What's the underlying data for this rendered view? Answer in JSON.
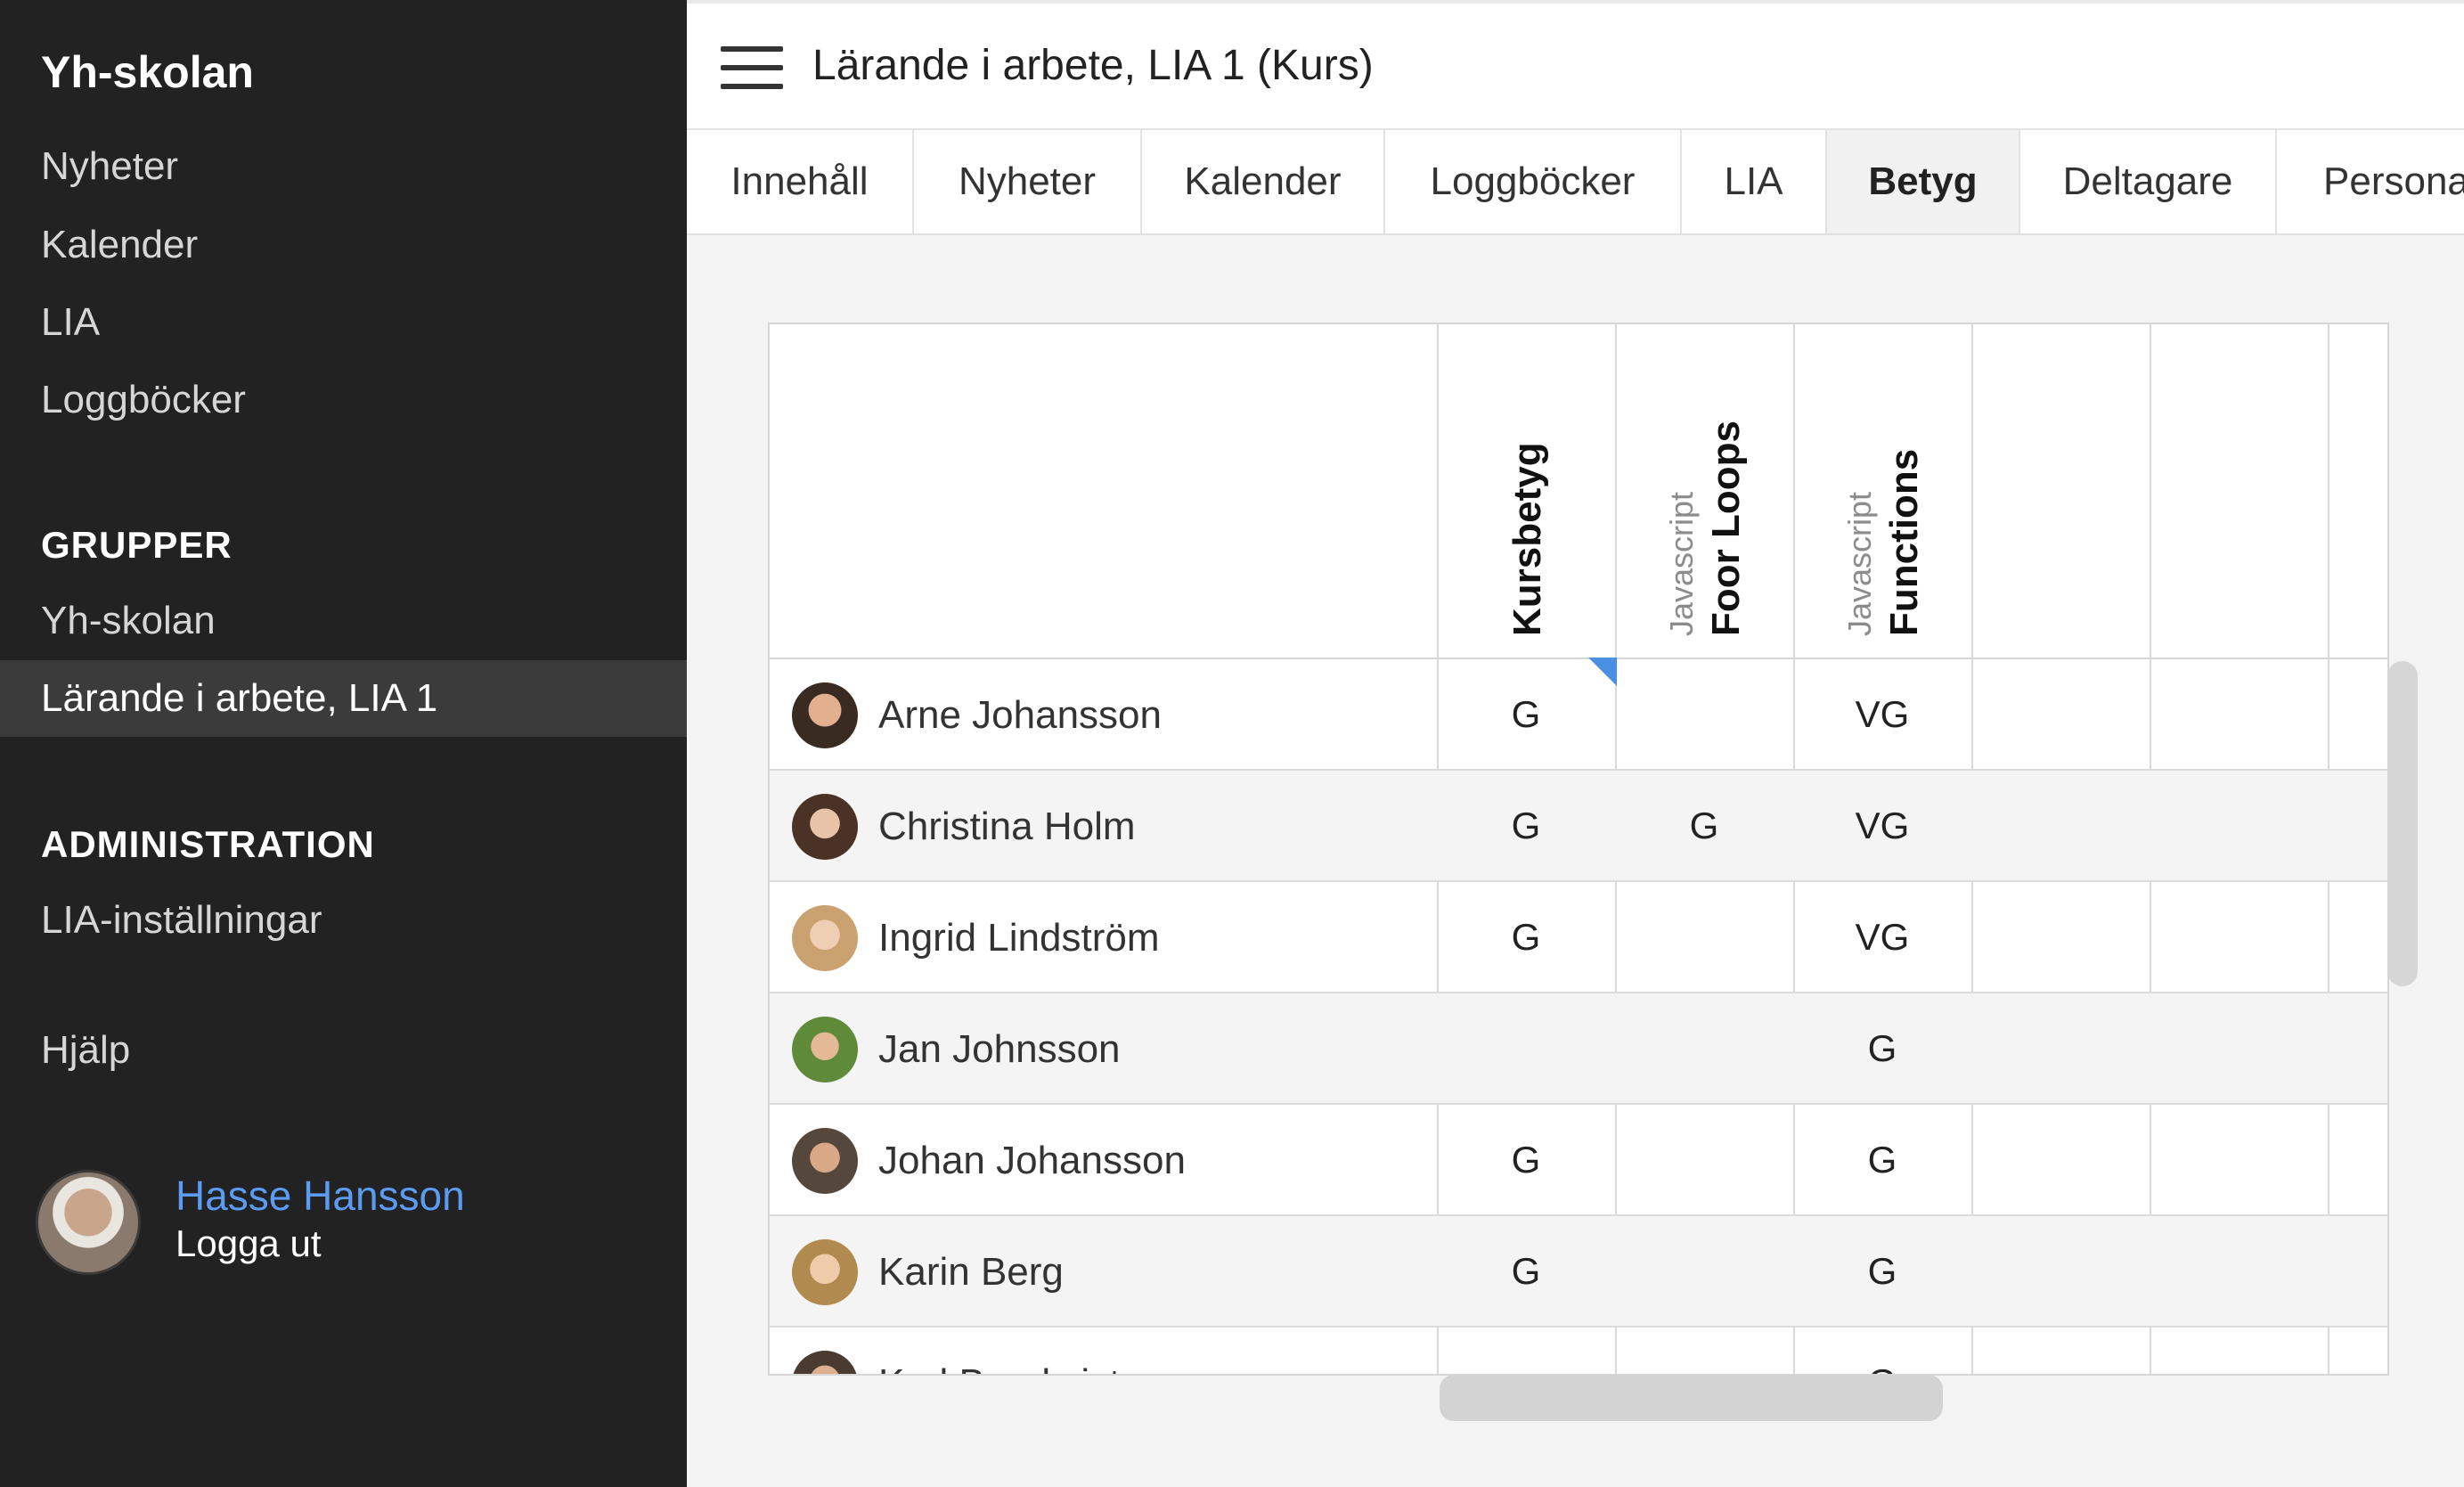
{
  "sidebar": {
    "brand": "Yh-skolan",
    "nav": [
      "Nyheter",
      "Kalender",
      "LIA",
      "Loggböcker"
    ],
    "groups_heading": "GRUPPER",
    "groups": [
      "Yh-skolan",
      "Lärande i arbete, LIA 1"
    ],
    "active_group": "Lärande i arbete, LIA 1",
    "admin_heading": "ADMINISTRATION",
    "admin_items": [
      "LIA-inställningar"
    ],
    "help": "Hjälp",
    "user": {
      "name": "Hasse Hansson",
      "logout": "Logga ut"
    }
  },
  "header": {
    "title": "Lärande i arbete, LIA 1 (Kurs)"
  },
  "tabs": [
    "Innehåll",
    "Nyheter",
    "Kalender",
    "Loggböcker",
    "LIA",
    "Betyg",
    "Deltagare",
    "Persona"
  ],
  "active_tab": "Betyg",
  "grid": {
    "columns": [
      {
        "title": "Kursbetyg",
        "course": ""
      },
      {
        "title": "Foor Loops",
        "course": "Javascript"
      },
      {
        "title": "Functions",
        "course": "Javascript"
      }
    ],
    "rows": [
      {
        "name": "Arne Johansson",
        "grades": [
          "G",
          "",
          "VG"
        ]
      },
      {
        "name": "Christina Holm",
        "grades": [
          "G",
          "G",
          "VG"
        ]
      },
      {
        "name": "Ingrid Lindström",
        "grades": [
          "G",
          "",
          "VG"
        ]
      },
      {
        "name": "Jan Johnsson",
        "grades": [
          "",
          "",
          "G"
        ]
      },
      {
        "name": "Johan Johansson",
        "grades": [
          "G",
          "",
          "G"
        ]
      },
      {
        "name": "Karin Berg",
        "grades": [
          "G",
          "",
          "G"
        ]
      },
      {
        "name": "Karl Bergkvist",
        "grades": [
          "",
          "",
          "G"
        ]
      }
    ]
  },
  "colors": {
    "sidebar_bg": "#222222",
    "sidebar_active_bg": "#3b3b3b",
    "link_blue": "#5b9cf2",
    "accent_mark": "#4a90e2"
  }
}
